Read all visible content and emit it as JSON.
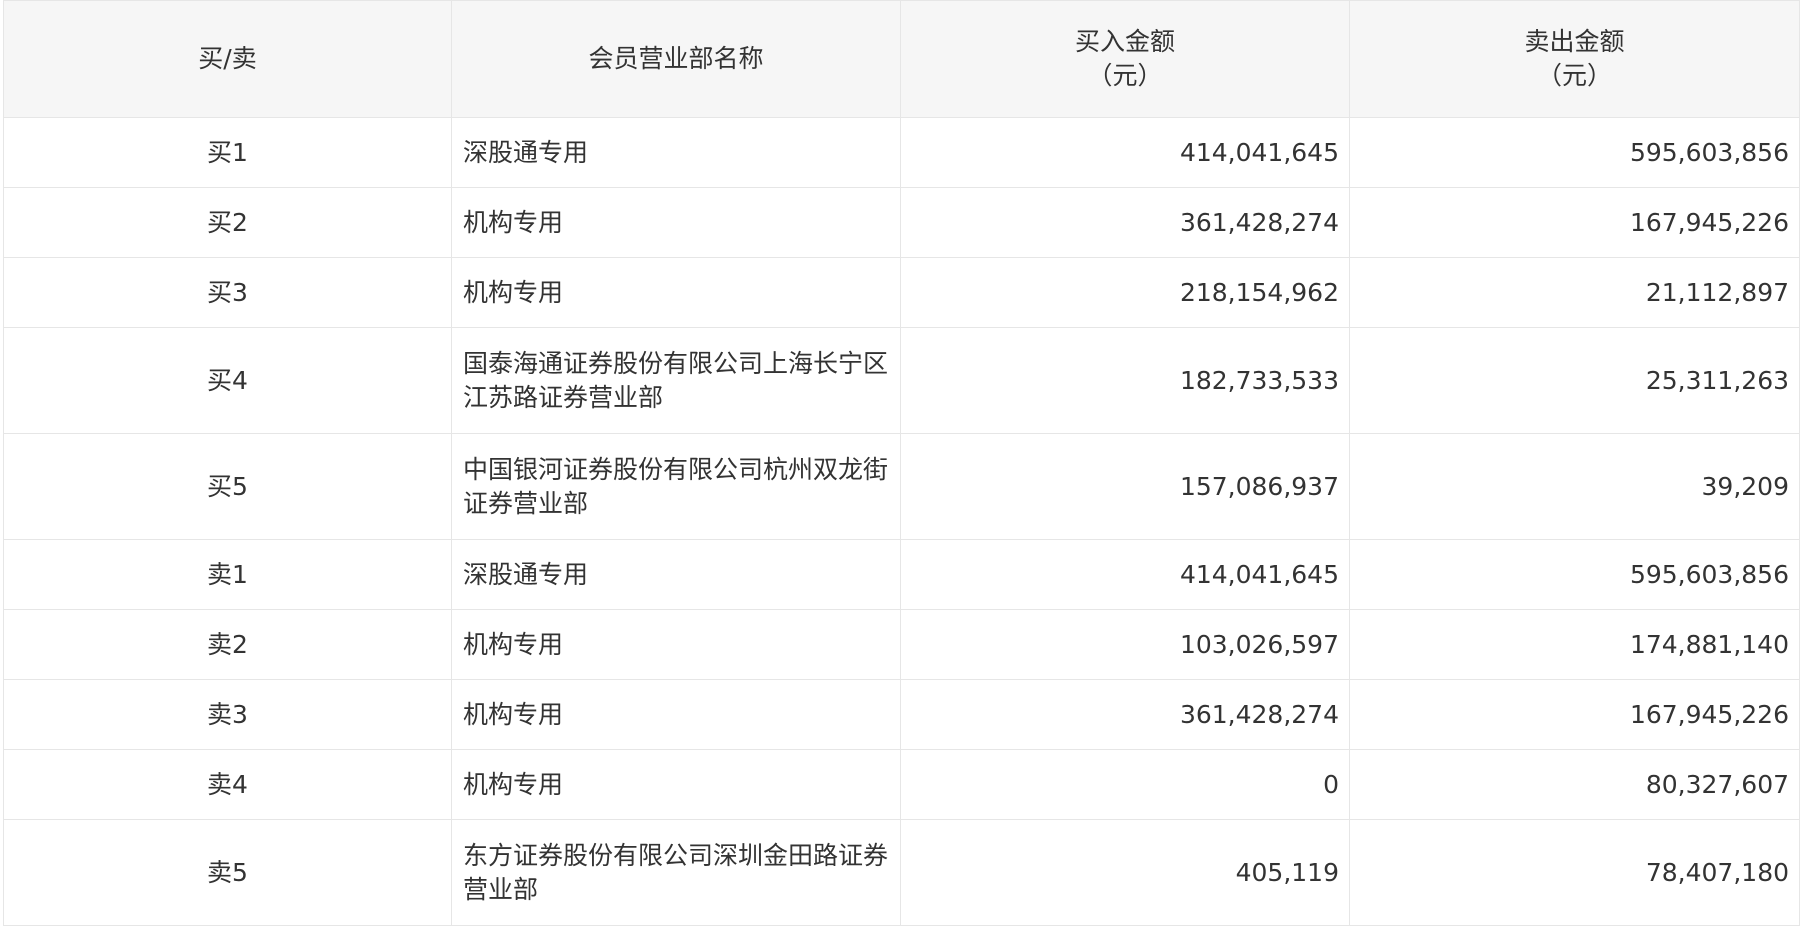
{
  "table": {
    "headers": {
      "side": "买/卖",
      "branch": "会员营业部名称",
      "buy_amount": "买入金额",
      "buy_unit": "（元）",
      "sell_amount": "卖出金额",
      "sell_unit": "（元）"
    },
    "rows": [
      {
        "side": "买1",
        "branch": "深股通专用",
        "buy": "414,041,645",
        "sell": "595,603,856"
      },
      {
        "side": "买2",
        "branch": "机构专用",
        "buy": "361,428,274",
        "sell": "167,945,226"
      },
      {
        "side": "买3",
        "branch": "机构专用",
        "buy": "218,154,962",
        "sell": "21,112,897"
      },
      {
        "side": "买4",
        "branch": "国泰海通证券股份有限公司上海长宁区江苏路证券营业部",
        "buy": "182,733,533",
        "sell": "25,311,263"
      },
      {
        "side": "买5",
        "branch": "中国银河证券股份有限公司杭州双龙街证券营业部",
        "buy": "157,086,937",
        "sell": "39,209"
      },
      {
        "side": "卖1",
        "branch": "深股通专用",
        "buy": "414,041,645",
        "sell": "595,603,856"
      },
      {
        "side": "卖2",
        "branch": "机构专用",
        "buy": "103,026,597",
        "sell": "174,881,140"
      },
      {
        "side": "卖3",
        "branch": "机构专用",
        "buy": "361,428,274",
        "sell": "167,945,226"
      },
      {
        "side": "卖4",
        "branch": "机构专用",
        "buy": "0",
        "sell": "80,327,607"
      },
      {
        "side": "卖5",
        "branch": "东方证券股份有限公司深圳金田路证券营业部",
        "buy": "405,119",
        "sell": "78,407,180"
      }
    ]
  }
}
